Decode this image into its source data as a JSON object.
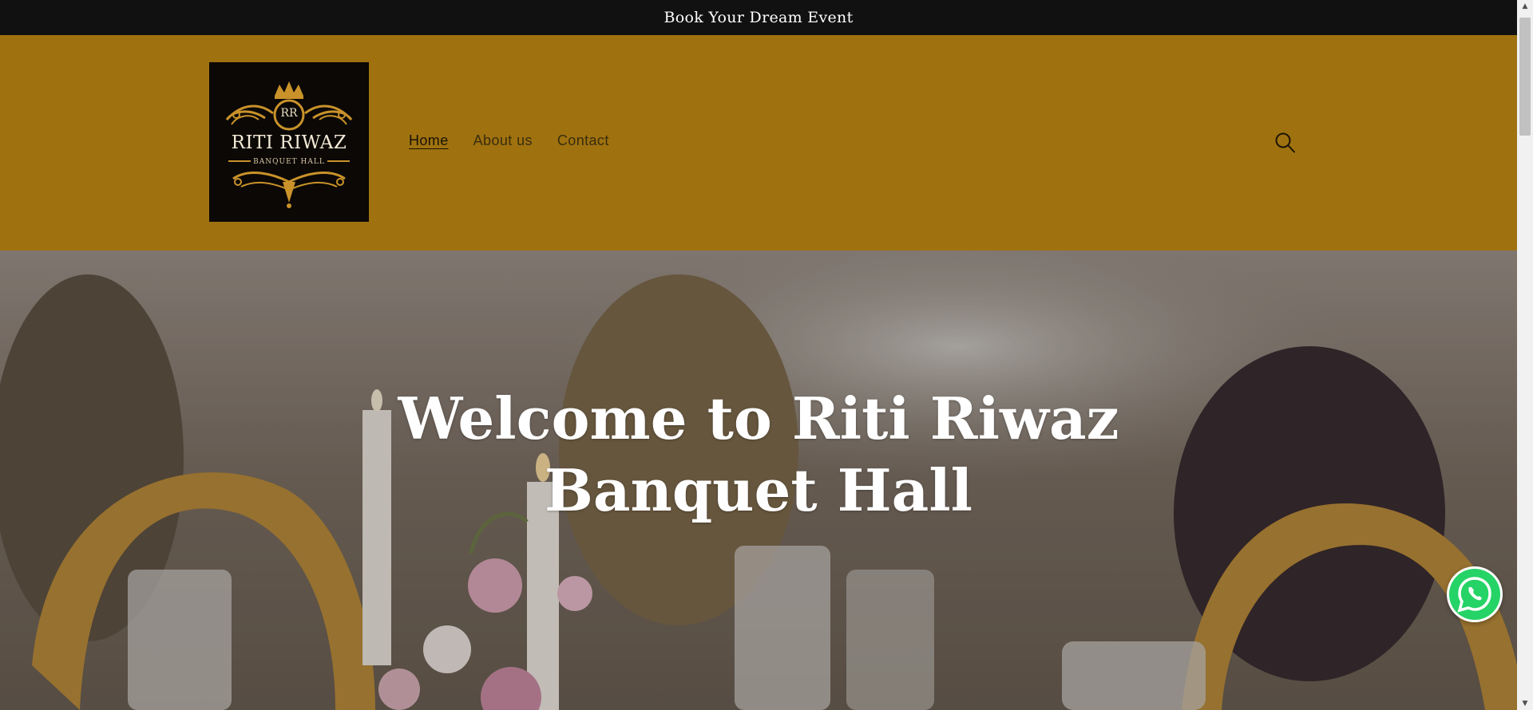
{
  "announcement": {
    "text": "Book Your Dream Event"
  },
  "logo": {
    "monogram": "RR",
    "title": "RITI RIWAZ",
    "subtitle": "BANQUET HALL"
  },
  "nav": {
    "items": [
      {
        "label": "Home",
        "active": true
      },
      {
        "label": "About us",
        "active": false
      },
      {
        "label": "Contact",
        "active": false
      }
    ]
  },
  "header": {
    "search_icon": "search-icon"
  },
  "hero": {
    "title": "Welcome to Riti Riwaz Banquet Hall"
  },
  "floating": {
    "icon": "whatsapp-icon",
    "color": "#25d366"
  },
  "colors": {
    "announcement_bg": "#111111",
    "header_bg": "#9f720f",
    "logo_bg": "#0b0806",
    "logo_gold": "#c9922a"
  }
}
